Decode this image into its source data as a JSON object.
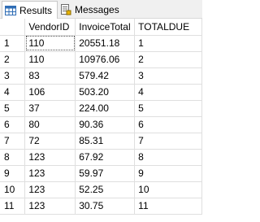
{
  "tabs": [
    {
      "label": "Results",
      "icon": "grid-icon",
      "active": true
    },
    {
      "label": "Messages",
      "icon": "messages-icon",
      "active": false
    }
  ],
  "grid": {
    "columns": [
      "",
      "VendorID",
      "InvoiceTotal",
      "TOTALDUE"
    ],
    "rows": [
      [
        "1",
        "110",
        "20551.18",
        "1"
      ],
      [
        "2",
        "110",
        "10976.06",
        "2"
      ],
      [
        "3",
        "83",
        "579.42",
        "3"
      ],
      [
        "4",
        "106",
        "503.20",
        "4"
      ],
      [
        "5",
        "37",
        "224.00",
        "5"
      ],
      [
        "6",
        "80",
        "90.36",
        "6"
      ],
      [
        "7",
        "72",
        "85.31",
        "7"
      ],
      [
        "8",
        "123",
        "67.92",
        "8"
      ],
      [
        "9",
        "123",
        "59.97",
        "9"
      ],
      [
        "10",
        "123",
        "52.25",
        "10"
      ],
      [
        "11",
        "123",
        "30.75",
        "11"
      ]
    ]
  },
  "colors": {
    "grid_line": "#dfdfdf",
    "tab_bar": "#f0f0f0",
    "grid_icon_blue": "#2f6db5"
  }
}
